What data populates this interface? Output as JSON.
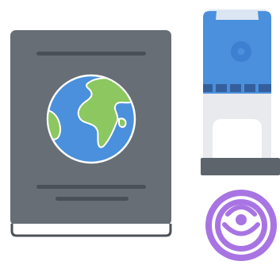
{
  "illustration": {
    "items": [
      "passport-book",
      "rubber-stamp",
      "stamp-imprint"
    ]
  },
  "colors": {
    "book_cover": "#676e76",
    "book_cover_lines": "#4a5057",
    "book_pages": "#ffffff",
    "book_edge": "#4c5258",
    "ocean": "#4a90dc",
    "land": "#8cc760",
    "globe_outline": "#ffffff",
    "stamp_handle": "#4a90dc",
    "stamp_handle_top": "#dbe6f2",
    "stamp_knob": "#3d7fd0",
    "stamp_body_stripe": "#355f9c",
    "stamp_frame": "#e8eaed",
    "stamp_base": "#5e646b",
    "imprint": "#a874e3",
    "imprint_inner": "#ffffff"
  }
}
